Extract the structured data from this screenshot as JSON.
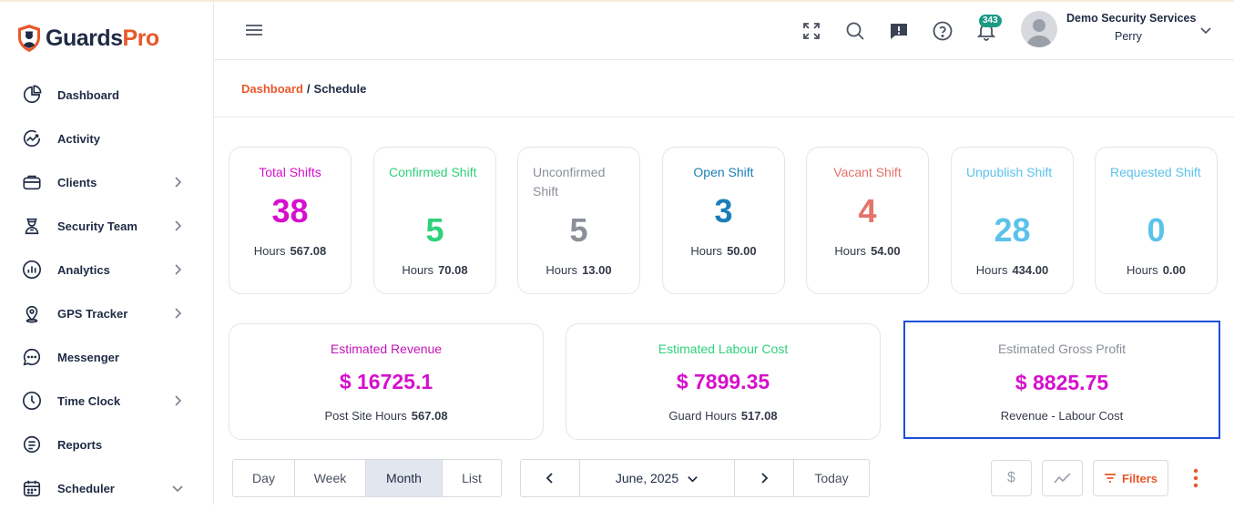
{
  "brand": {
    "name_part1": "Guards",
    "name_part2": "Pro",
    "accent": "#e8572a",
    "dark": "#1f2a44"
  },
  "sidebar": {
    "items": [
      {
        "label": "Dashboard",
        "icon": "pie-chart-icon",
        "has_chevron": false
      },
      {
        "label": "Activity",
        "icon": "activity-icon",
        "has_chevron": false
      },
      {
        "label": "Clients",
        "icon": "briefcase-icon",
        "has_chevron": true
      },
      {
        "label": "Security Team",
        "icon": "guard-icon",
        "has_chevron": true
      },
      {
        "label": "Analytics",
        "icon": "analytics-icon",
        "has_chevron": true
      },
      {
        "label": "GPS Tracker",
        "icon": "location-pin-icon",
        "has_chevron": true
      },
      {
        "label": "Messenger",
        "icon": "chat-bubble-icon",
        "has_chevron": false
      },
      {
        "label": "Time Clock",
        "icon": "clock-icon",
        "has_chevron": true
      },
      {
        "label": "Reports",
        "icon": "report-icon",
        "has_chevron": false
      },
      {
        "label": "Scheduler",
        "icon": "calendar-icon",
        "has_chevron": true
      }
    ]
  },
  "header": {
    "notifications_count": "343",
    "user_company": "Demo Security Services",
    "user_name": "Perry"
  },
  "breadcrumb": {
    "root": "Dashboard",
    "separator": "/",
    "current": "Schedule"
  },
  "stats": [
    {
      "title": "Total Shifts",
      "value": "38",
      "hours_label": "Hours",
      "hours": "567.08",
      "color": "#d60fcd",
      "num_color": "#d60fcd",
      "title_align": "center"
    },
    {
      "title": "Confirmed Shift",
      "value": "5",
      "hours_label": "Hours",
      "hours": "70.08",
      "color": "#2fd17a",
      "num_color": "#2fd17a",
      "title_align": "left"
    },
    {
      "title": "Unconfirmed Shift",
      "value": "5",
      "hours_label": "Hours",
      "hours": "13.00",
      "color": "#8a8f98",
      "num_color": "#8a8f98",
      "title_align": "left"
    },
    {
      "title": "Open Shift",
      "value": "3",
      "hours_label": "Hours",
      "hours": "50.00",
      "color": "#1a7fb8",
      "num_color": "#1a7fb8",
      "title_align": "center"
    },
    {
      "title": "Vacant Shift",
      "value": "4",
      "hours_label": "Hours",
      "hours": "54.00",
      "color": "#e4736a",
      "num_color": "#e4736a",
      "title_align": "center"
    },
    {
      "title": "Unpublish Shift",
      "value": "28",
      "hours_label": "Hours",
      "hours": "434.00",
      "color": "#5bc2ea",
      "num_color": "#5bc2ea",
      "title_align": "left"
    },
    {
      "title": "Requested Shift",
      "value": "0",
      "hours_label": "Hours",
      "hours": "0.00",
      "color": "#5bc2ea",
      "num_color": "#5bc2ea",
      "title_align": "left"
    }
  ],
  "finance": [
    {
      "title": "Estimated Revenue",
      "value": "$ 16725.1",
      "sub_label": "Post Site Hours",
      "sub_value": "567.08",
      "title_color": "#c516b8"
    },
    {
      "title": "Estimated Labour Cost",
      "value": "$ 7899.35",
      "sub_label": "Guard Hours",
      "sub_value": "517.08",
      "title_color": "#2fd17a"
    },
    {
      "title": "Estimated Gross Profit",
      "value": "$ 8825.75",
      "sub_label": "Revenue - Labour Cost",
      "sub_value": "",
      "title_color": "#8a8f98"
    }
  ],
  "view_tabs": {
    "day": "Day",
    "week": "Week",
    "month": "Month",
    "list": "List",
    "active": "Month"
  },
  "date_nav": {
    "prev": "‹",
    "current": "June, 2025",
    "next": "›",
    "today": "Today"
  },
  "tools": {
    "currency_symbol": "$",
    "filters": "Filters"
  }
}
